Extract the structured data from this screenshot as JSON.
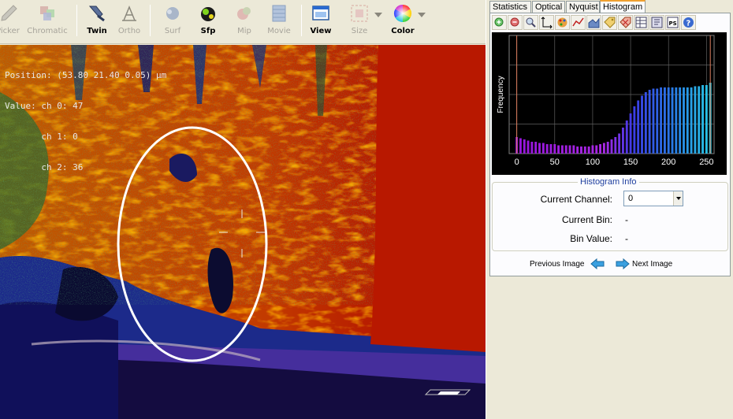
{
  "toolbar": {
    "buttons": [
      {
        "label": "Picker",
        "icon": "picker-icon",
        "enabled": false
      },
      {
        "label": "Chromatic",
        "icon": "chromatic-icon",
        "enabled": false
      },
      {
        "label": "Twin",
        "icon": "twin-icon",
        "enabled": true
      },
      {
        "label": "Ortho",
        "icon": "ortho-icon",
        "enabled": false
      },
      {
        "label": "Surf",
        "icon": "surf-icon",
        "enabled": false
      },
      {
        "label": "Sfp",
        "icon": "sfp-icon",
        "enabled": true
      },
      {
        "label": "Mip",
        "icon": "mip-icon",
        "enabled": false
      },
      {
        "label": "Movie",
        "icon": "movie-icon",
        "enabled": false
      },
      {
        "label": "View",
        "icon": "view-icon",
        "enabled": true
      },
      {
        "label": "Size",
        "icon": "size-icon",
        "enabled": false
      },
      {
        "label": "Color",
        "icon": "color-wheel-icon",
        "enabled": true
      }
    ]
  },
  "viewer": {
    "readout": {
      "position": "Position: (53.80 21.40 0.05) µm",
      "value": "Value: ch 0: 47",
      "ch1": "       ch 1: 0",
      "ch2": "       ch 2: 36"
    },
    "colors": {
      "background": "#b81c00",
      "annotation": "#ffffff"
    }
  },
  "tabs": [
    {
      "label": "Statistics",
      "active": false
    },
    {
      "label": "Optical",
      "active": false
    },
    {
      "label": "Nyquist",
      "active": false
    },
    {
      "label": "Histogram",
      "active": true
    }
  ],
  "histogram_tools": [
    "zoom-in-icon",
    "zoom-out-icon",
    "zoom-fit-icon",
    "axis-icon",
    "palette-icon",
    "line-chart-icon",
    "area-chart-icon",
    "tag-icon",
    "tag-remove-icon",
    "table-icon",
    "export-icon",
    "ps-icon",
    "help-icon"
  ],
  "chart_data": {
    "type": "bar",
    "ylabel": "Frequency",
    "xlabel": "",
    "xlim": [
      -10,
      260
    ],
    "xticks": [
      0,
      50,
      100,
      150,
      200,
      250
    ],
    "grid": true,
    "markers": [
      0,
      255
    ],
    "bins_x": [
      0,
      5,
      10,
      15,
      20,
      25,
      30,
      35,
      40,
      45,
      50,
      55,
      60,
      65,
      70,
      75,
      80,
      85,
      90,
      95,
      100,
      105,
      110,
      115,
      120,
      125,
      130,
      135,
      140,
      145,
      150,
      155,
      160,
      165,
      170,
      175,
      180,
      185,
      190,
      195,
      200,
      205,
      210,
      215,
      220,
      225,
      230,
      235,
      240,
      245,
      250,
      255
    ],
    "values": [
      14,
      13,
      12,
      11,
      10,
      10,
      9,
      9,
      8,
      8,
      8,
      7,
      7,
      7,
      7,
      7,
      6,
      6,
      6,
      6,
      7,
      7,
      8,
      9,
      10,
      12,
      14,
      17,
      22,
      28,
      34,
      40,
      45,
      49,
      52,
      54,
      55,
      55,
      56,
      56,
      56,
      56,
      56,
      56,
      56,
      56,
      56,
      57,
      57,
      58,
      58,
      60
    ],
    "ylim": [
      0,
      100
    ]
  },
  "histogram_info": {
    "title": "Histogram Info",
    "current_channel_label": "Current Channel:",
    "current_channel_value": "0",
    "current_bin_label": "Current Bin:",
    "current_bin_value": "-",
    "bin_value_label": "Bin Value:",
    "bin_value_value": "-"
  },
  "navigation": {
    "previous_label": "Previous Image",
    "next_label": "Next Image"
  }
}
